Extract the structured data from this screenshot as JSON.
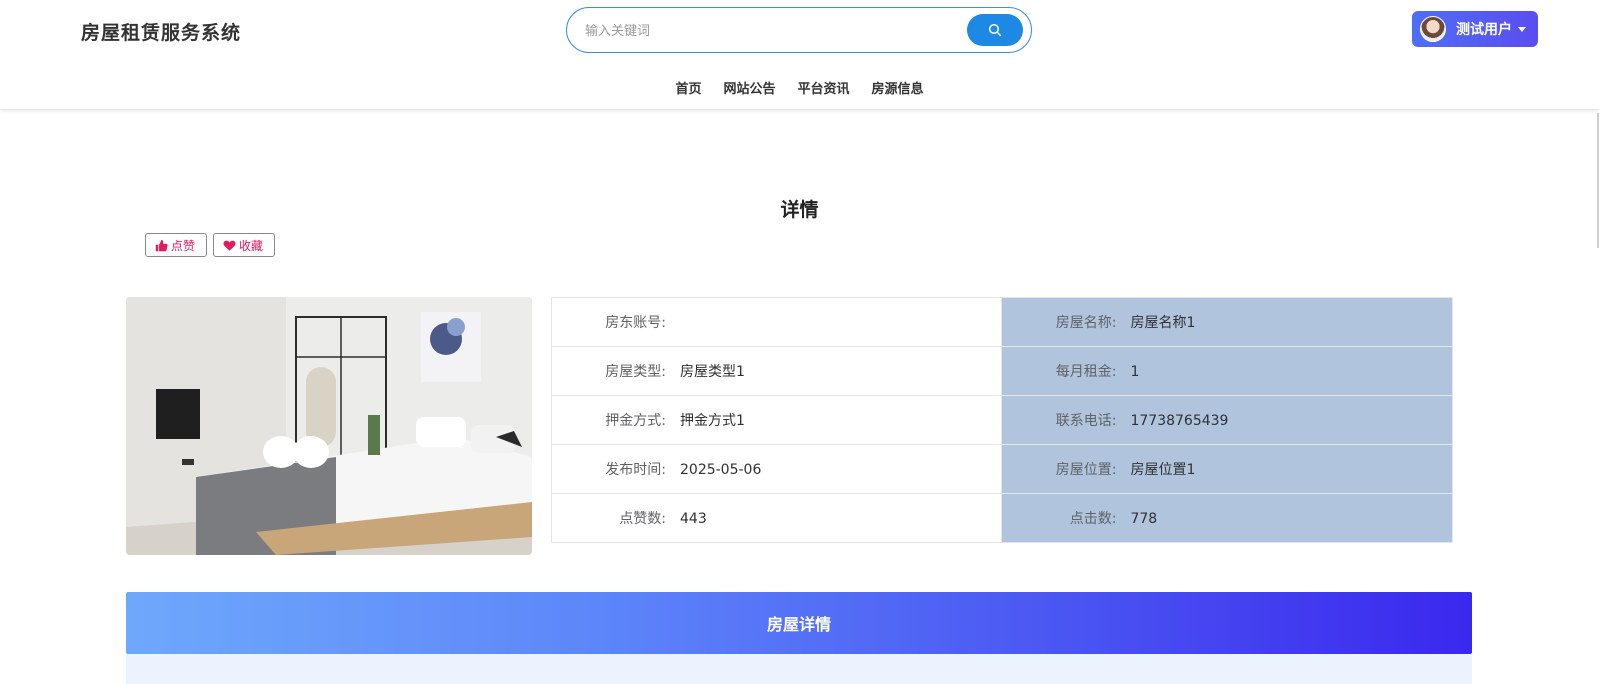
{
  "header": {
    "site_title": "房屋租赁服务系统",
    "search_placeholder": "输入关键词",
    "user_name": "测试用户"
  },
  "nav": {
    "items": [
      "首页",
      "网站公告",
      "平台资讯",
      "房源信息"
    ]
  },
  "detail": {
    "title": "详情",
    "like_label": "点赞",
    "favorite_label": "收藏"
  },
  "info": {
    "rows": [
      {
        "left_label": "房东账号:",
        "left_value": "",
        "right_label": "房屋名称:",
        "right_value": "房屋名称1"
      },
      {
        "left_label": "房屋类型:",
        "left_value": "房屋类型1",
        "right_label": "每月租金:",
        "right_value": "1"
      },
      {
        "left_label": "押金方式:",
        "left_value": "押金方式1",
        "right_label": "联系电话:",
        "right_value": "17738765439"
      },
      {
        "left_label": "发布时间:",
        "left_value": "2025-05-06",
        "right_label": "房屋位置:",
        "right_value": "房屋位置1"
      },
      {
        "left_label": "点赞数:",
        "left_value": "443",
        "right_label": "点击数:",
        "right_value": "778"
      }
    ]
  },
  "section": {
    "title": "房屋详情"
  },
  "colors": {
    "accent_blue": "#1e88e5",
    "accent_pink": "#e6195c",
    "info_right_bg": "#b0c4de"
  }
}
